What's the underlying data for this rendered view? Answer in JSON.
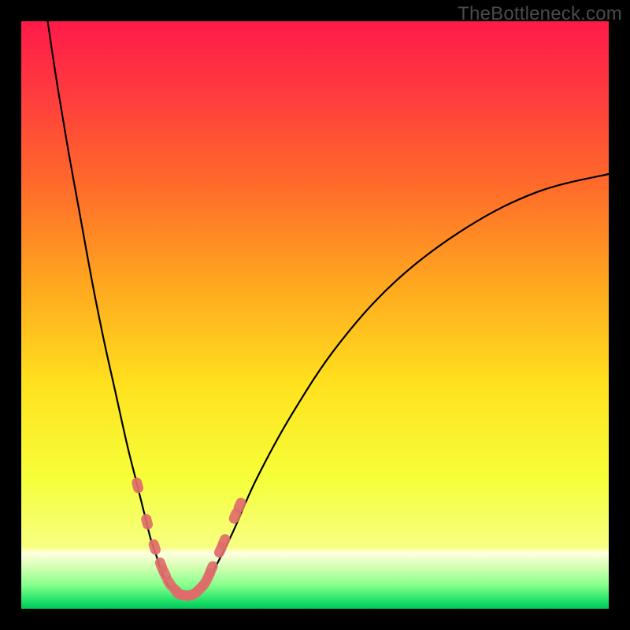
{
  "watermark": "TheBottleneck.com",
  "colors": {
    "frame": "#000000",
    "curve": "#000000",
    "dot_fill": "#de6d6a",
    "dot_stroke": "#c85a57",
    "gradient_stops": [
      {
        "offset": 0.0,
        "color": "#ff1a49"
      },
      {
        "offset": 0.12,
        "color": "#ff3a3f"
      },
      {
        "offset": 0.28,
        "color": "#ff6b2a"
      },
      {
        "offset": 0.45,
        "color": "#ffa81f"
      },
      {
        "offset": 0.62,
        "color": "#ffe21e"
      },
      {
        "offset": 0.78,
        "color": "#f6ff3a"
      },
      {
        "offset": 0.895,
        "color": "#f7ff82"
      },
      {
        "offset": 0.905,
        "color": "#ffffe0"
      },
      {
        "offset": 0.93,
        "color": "#d2ffb0"
      },
      {
        "offset": 0.96,
        "color": "#86ff8c"
      },
      {
        "offset": 0.985,
        "color": "#25e46a"
      },
      {
        "offset": 1.0,
        "color": "#00c85a"
      }
    ]
  },
  "chart_data": {
    "type": "line",
    "title": "",
    "xlabel": "",
    "ylabel": "",
    "xlim": [
      0,
      100
    ],
    "ylim": [
      0,
      100
    ],
    "grid": false,
    "legend": false,
    "series": [
      {
        "name": "left-curve",
        "x": [
          4.5,
          6,
          8,
          10,
          12,
          14,
          16,
          18,
          19.5,
          21,
          22,
          23,
          24,
          25,
          26
        ],
        "y": [
          100,
          90,
          78,
          67,
          56,
          46,
          37,
          28,
          22,
          16,
          12,
          9,
          6,
          4,
          3
        ]
      },
      {
        "name": "valley-floor",
        "x": [
          26,
          27,
          28,
          29,
          30,
          31
        ],
        "y": [
          3,
          2.4,
          2.2,
          2.3,
          2.8,
          3.5
        ]
      },
      {
        "name": "right-curve",
        "x": [
          31,
          33,
          36,
          40,
          46,
          54,
          64,
          76,
          88,
          100
        ],
        "y": [
          3.5,
          7,
          13,
          22,
          33,
          45,
          56,
          65,
          71,
          74
        ]
      }
    ],
    "points": {
      "name": "highlight-dots",
      "x": [
        19.8,
        21.4,
        22.7,
        23.8,
        24.4,
        25.2,
        26.4,
        27.0,
        27.9,
        28.7,
        29.5,
        30.3,
        31.2,
        31.9,
        32.4,
        33.9,
        34.5,
        36.4,
        37.2
      ],
      "y": [
        21.0,
        14.8,
        10.5,
        7.4,
        6.0,
        4.4,
        3.0,
        2.5,
        2.3,
        2.3,
        2.6,
        3.3,
        4.3,
        5.6,
        6.8,
        10.0,
        11.4,
        15.8,
        17.6
      ]
    }
  }
}
